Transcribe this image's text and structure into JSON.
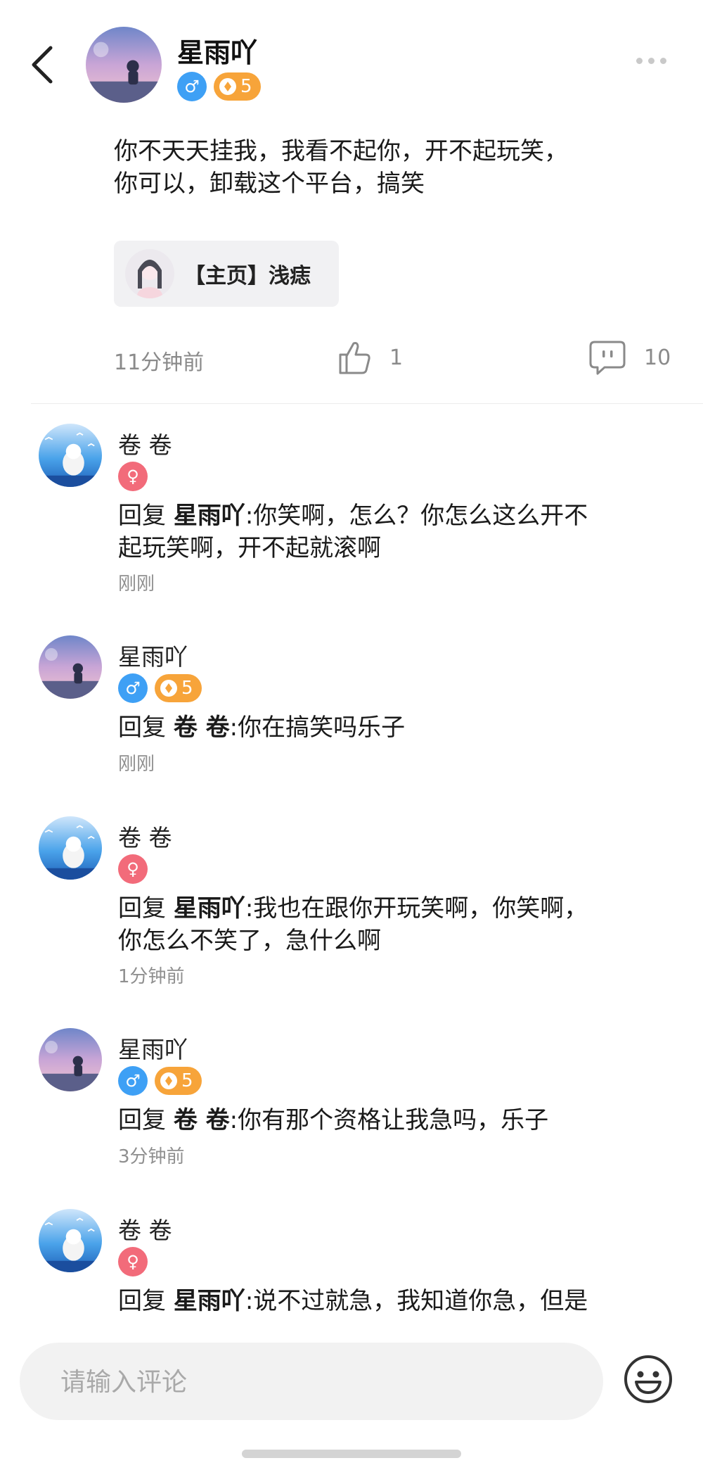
{
  "post": {
    "author": "星雨吖",
    "level": "5",
    "text_lines": [
      "你不天天挂我，我看不起你，开不起玩笑，",
      "你可以，卸载这个平台，搞笑"
    ],
    "link_card": "【主页】浅痣",
    "time": "11分钟前",
    "likes": "1",
    "comments": "10"
  },
  "comments": [
    {
      "name": "卷 卷",
      "gender": "female",
      "reply_prefix": "回复 ",
      "reply_to": "星雨吖",
      "lines": [
        ":你笑啊，怎么？你怎么这么开不",
        "起玩笑啊，开不起就滚啊"
      ],
      "time": "刚刚"
    },
    {
      "name": "星雨吖",
      "gender": "male",
      "level": "5",
      "reply_prefix": "回复 ",
      "reply_to": "卷 卷",
      "lines": [
        ":你在搞笑吗乐子"
      ],
      "time": "刚刚"
    },
    {
      "name": "卷 卷",
      "gender": "female",
      "reply_prefix": "回复 ",
      "reply_to": "星雨吖",
      "lines": [
        ":我也在跟你开玩笑啊，你笑啊，",
        "你怎么不笑了，急什么啊"
      ],
      "time": "1分钟前"
    },
    {
      "name": "星雨吖",
      "gender": "male",
      "level": "5",
      "reply_prefix": "回复 ",
      "reply_to": "卷 卷",
      "lines": [
        ":你有那个资格让我急吗，乐子"
      ],
      "time": "3分钟前"
    },
    {
      "name": "卷 卷",
      "gender": "female",
      "reply_prefix": "回复 ",
      "reply_to": "星雨吖",
      "lines": [
        ":说不过就急，我知道你急，但是"
      ],
      "time": ""
    }
  ],
  "input": {
    "placeholder": "请输入评论"
  },
  "colors": {
    "male": "#3ea0f5",
    "female": "#f26b7a",
    "level": "#f7a43a"
  }
}
